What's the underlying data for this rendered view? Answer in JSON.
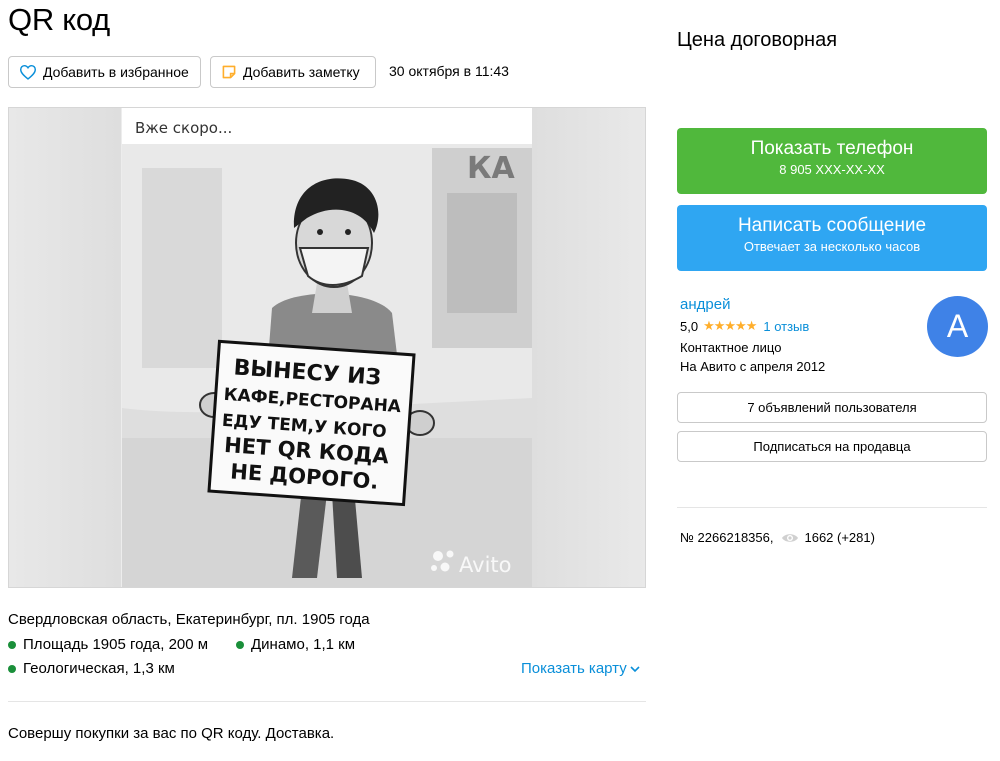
{
  "title": "QR код",
  "actions": {
    "favorite_label": "Добавить в избранное",
    "note_label": "Добавить заметку",
    "date": "30 октября в 11:43"
  },
  "photo": {
    "caption": "Вже скоро...",
    "sign_lines": [
      "ВЫНЕСУ ИЗ",
      "КАФЕ,РЕСТОРАНА",
      "ЕДУ ТЕМ,У КОГО",
      "НЕТ QR КОДА",
      "НЕ ДОРОГО."
    ],
    "watermark": "Avito",
    "wall_text": "КА"
  },
  "location": {
    "address": "Свердловская область, Екатеринбург, пл. 1905 года",
    "metro": [
      {
        "name": "Площадь 1905 года, 200 м",
        "color": "#1a8f3a"
      },
      {
        "name": "Динамо, 1,1 км",
        "color": "#1a8f3a"
      },
      {
        "name": "Геологическая, 1,3 км",
        "color": "#1a8f3a"
      }
    ],
    "show_map_label": "Показать карту"
  },
  "description": "Совершу покупки за вас по QR коду. Доставка.",
  "sidebar": {
    "price": "Цена договорная",
    "phone_button": {
      "label": "Показать телефон",
      "sub": "8 905 XXX-XX-XX",
      "color": "#50b83c"
    },
    "message_button": {
      "label": "Написать сообщение",
      "sub": "Отвечает за несколько часов",
      "color": "#2fa6f2"
    },
    "seller": {
      "name": "андрей",
      "rating": "5,0",
      "stars": 5,
      "reviews": "1 отзыв",
      "role": "Контактное лицо",
      "since": "На Авито с апреля 2012",
      "avatar_letter": "А",
      "avatar_color": "#3f82e7"
    },
    "user_ads_label": "7 объявлений пользователя",
    "subscribe_label": "Подписаться на продавца",
    "ad_number": "№ 2266218356,",
    "views": "1662 (+281)"
  }
}
